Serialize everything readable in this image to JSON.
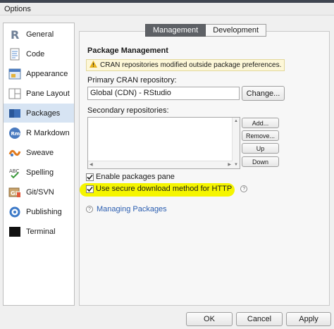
{
  "window": {
    "title": "Options"
  },
  "sidebar": {
    "items": [
      {
        "label": "General",
        "icon": "r-logo-icon",
        "selected": false
      },
      {
        "label": "Code",
        "icon": "code-icon",
        "selected": false
      },
      {
        "label": "Appearance",
        "icon": "appearance-icon",
        "selected": false
      },
      {
        "label": "Pane Layout",
        "icon": "pane-layout-icon",
        "selected": false
      },
      {
        "label": "Packages",
        "icon": "packages-icon",
        "selected": true
      },
      {
        "label": "R Markdown",
        "icon": "rmd-icon",
        "selected": false
      },
      {
        "label": "Sweave",
        "icon": "sweave-icon",
        "selected": false
      },
      {
        "label": "Spelling",
        "icon": "spelling-icon",
        "selected": false
      },
      {
        "label": "Git/SVN",
        "icon": "git-icon",
        "selected": false
      },
      {
        "label": "Publishing",
        "icon": "publishing-icon",
        "selected": false
      },
      {
        "label": "Terminal",
        "icon": "terminal-icon",
        "selected": false
      }
    ]
  },
  "tabs": [
    {
      "label": "Management",
      "active": true
    },
    {
      "label": "Development",
      "active": false
    }
  ],
  "section": {
    "title": "Package Management",
    "warning": "CRAN repositories modified outside package preferences."
  },
  "primary_repo": {
    "label": "Primary CRAN repository:",
    "value": "Global (CDN) - RStudio",
    "change_button": "Change..."
  },
  "secondary_repo": {
    "label": "Secondary repositories:",
    "add_button": "Add...",
    "remove_button": "Remove...",
    "up_button": "Up",
    "down_button": "Down"
  },
  "options": {
    "enable_packages_pane": {
      "label": "Enable packages pane",
      "checked": true
    },
    "secure_download": {
      "label": "Use secure download method for HTTP",
      "checked": true
    }
  },
  "help_link": "Managing Packages",
  "footer": {
    "ok": "OK",
    "cancel": "Cancel",
    "apply": "Apply"
  },
  "colors": {
    "selected_row": "#d7e4f3",
    "active_tab": "#5e6166",
    "highlight": "#f5f500",
    "link": "#2a5db0",
    "warning_bg": "#fdf7d8"
  }
}
